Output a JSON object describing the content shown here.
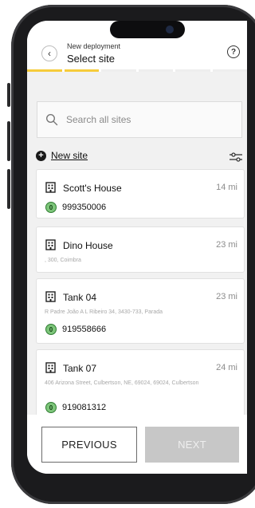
{
  "header": {
    "subtitle": "New deployment",
    "title": "Select site",
    "back_icon": "chevron-left-icon",
    "help_icon": "question-circle-icon",
    "progress": {
      "steps": 6,
      "active_steps": 2,
      "accent": "#f6cc3b"
    }
  },
  "search": {
    "placeholder": "Search all sites",
    "value": ""
  },
  "actions": {
    "new_site_label": "New site"
  },
  "sites": [
    {
      "name": "Scott's House",
      "distance": "14 mi",
      "address": "",
      "phone": "999350006",
      "badge": "0"
    },
    {
      "name": "Dino House",
      "distance": "23 mi",
      "address": ", 300, Coimbra",
      "phone": "",
      "badge": ""
    },
    {
      "name": "Tank 04",
      "distance": "23 mi",
      "address": "R Padre João A L Ribeiro 34, 3430-733, Parada",
      "phone": "919558666",
      "badge": "0"
    },
    {
      "name": "Tank 07",
      "distance": "24 mi",
      "address": "406 Arizona Street, Culbertson, NE, 69024, 69024, Culbertson",
      "phone": "919081312",
      "badge": "0"
    }
  ],
  "footer": {
    "previous_label": "PREVIOUS",
    "next_label": "NEXT"
  }
}
